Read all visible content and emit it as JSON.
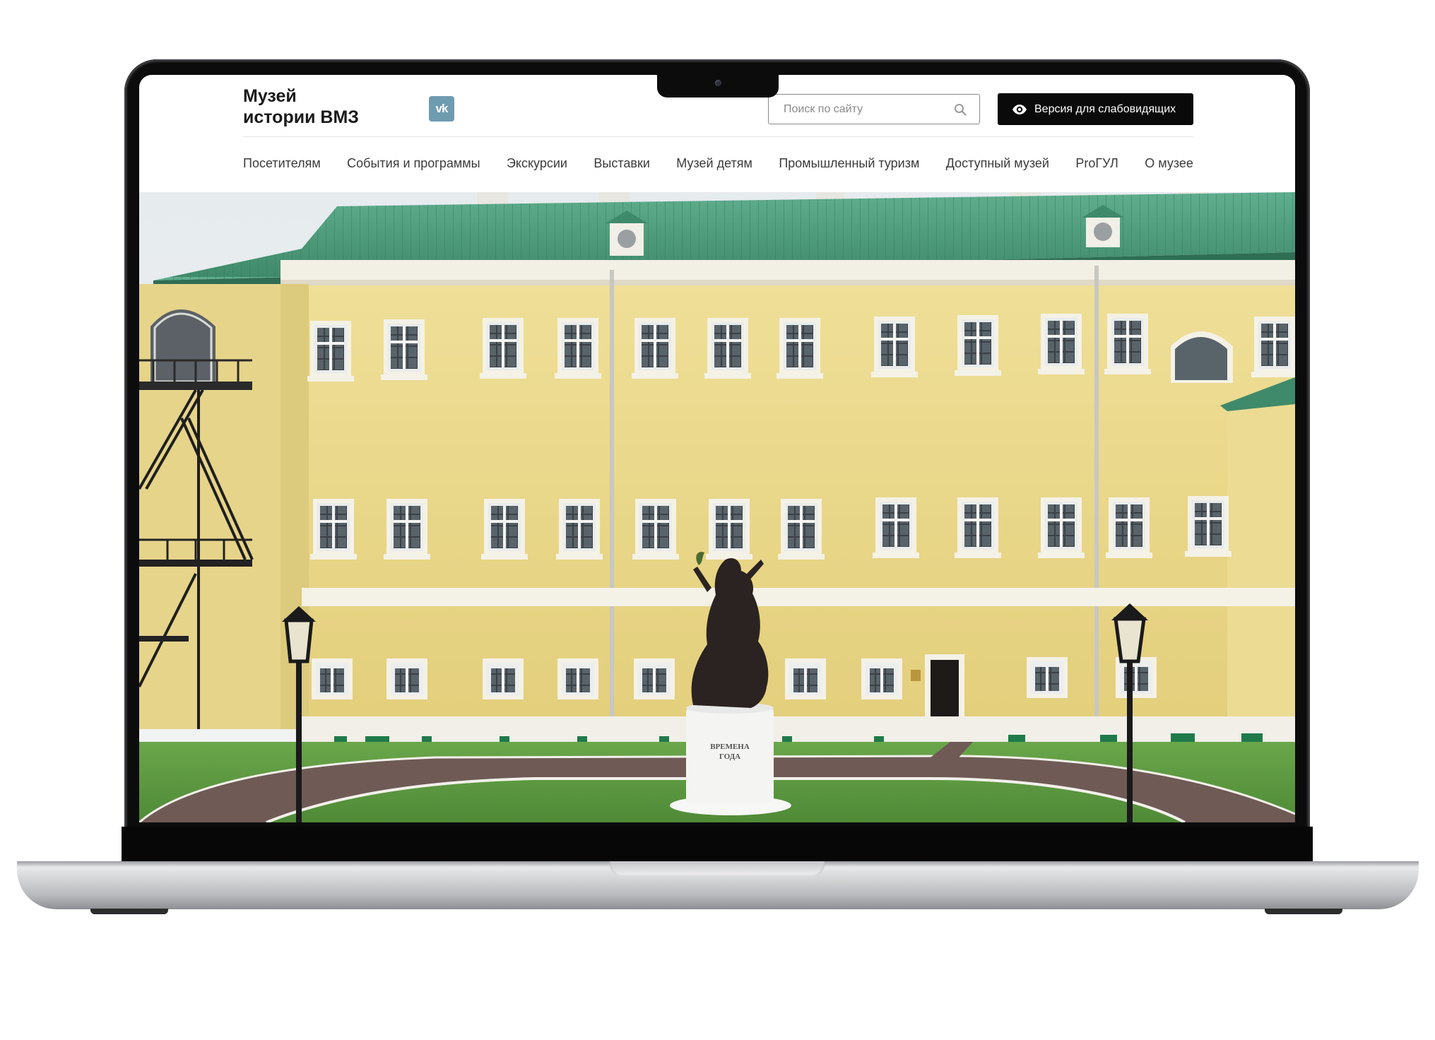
{
  "site": {
    "logo_line1": "Музей",
    "logo_line2": "истории ВМЗ",
    "social_vk": "vk",
    "search_placeholder": "Поиск по сайту",
    "a11y_label": "Версия для слабовидящих"
  },
  "nav": {
    "items": [
      "Посетителям",
      "События и программы",
      "Экскурсии",
      "Выставки",
      "Музей детям",
      "Промышленный туризм",
      "Доступный музей",
      "ProГУЛ",
      "О музее"
    ]
  },
  "hero": {
    "monument_inscription_line1": "ВРЕМЕНА",
    "monument_inscription_line2": "ГОДА"
  },
  "colors": {
    "facade": "#ecd98b",
    "roof": "#4e9e7e",
    "lawn": "#5f9a42",
    "accent_button": "#0a0a0a",
    "vk": "#6f9bb0"
  }
}
